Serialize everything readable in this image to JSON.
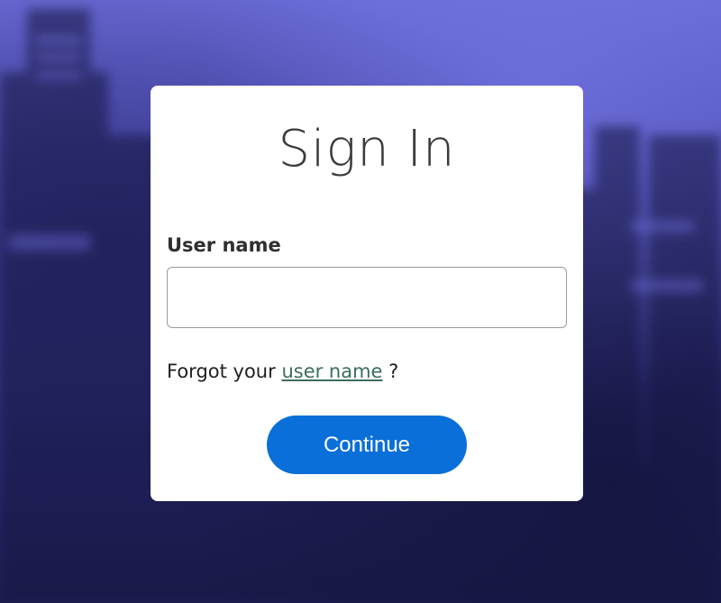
{
  "signin": {
    "title": "Sign In",
    "username_label": "User name",
    "username_value": "",
    "forgot_prefix": "Forgot your",
    "forgot_link": "user name",
    "forgot_suffix": "?",
    "continue_label": "Continue"
  },
  "colors": {
    "primary_button": "#0a6fd8",
    "link": "#3c6e5b",
    "background_tint": "#4b4bb2"
  }
}
